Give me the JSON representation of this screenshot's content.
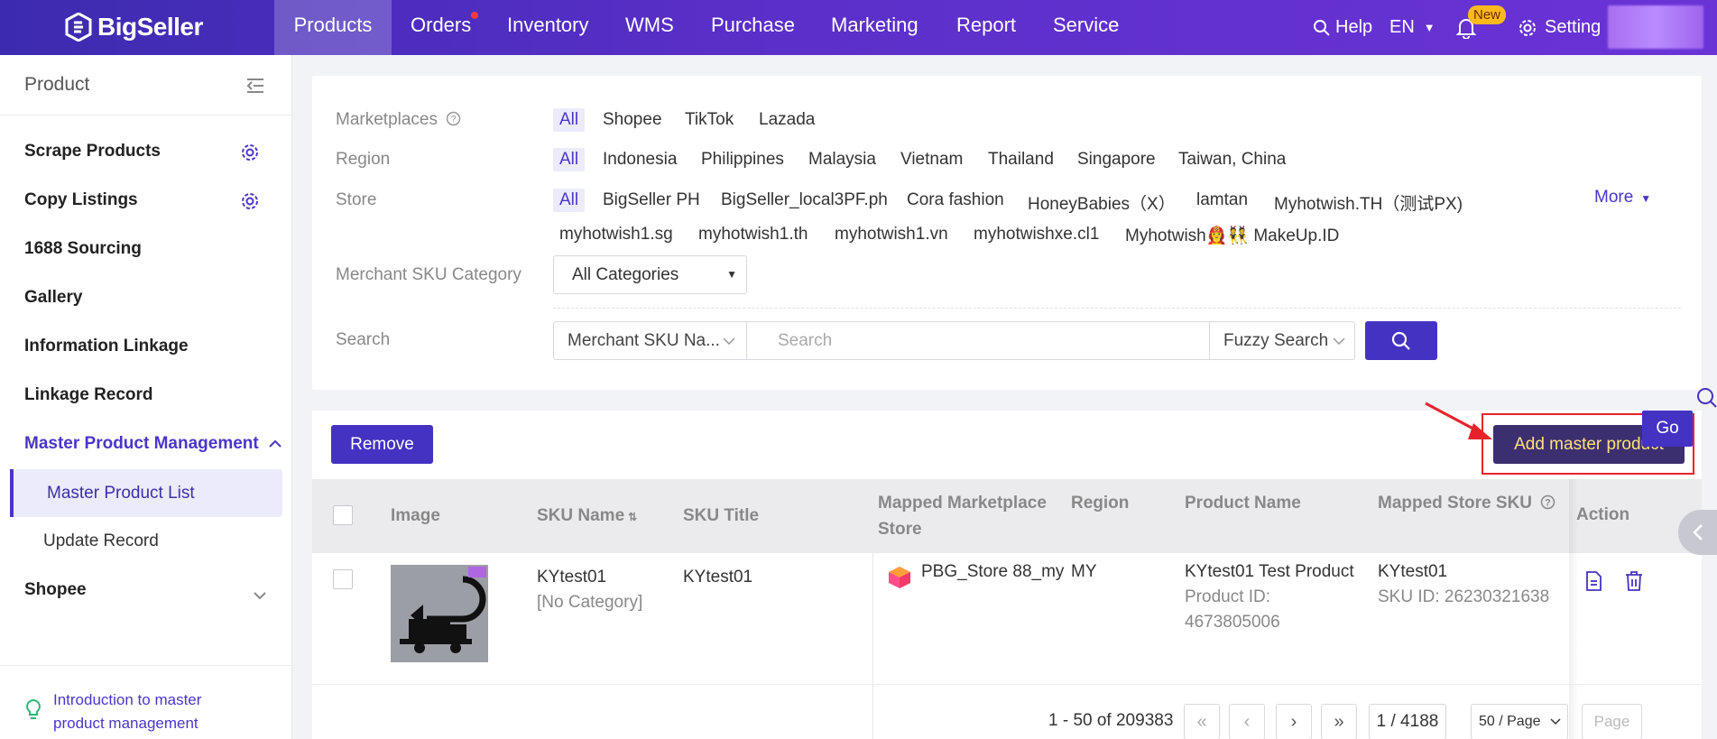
{
  "brand": {
    "name": "BigSeller"
  },
  "topnav": {
    "items": [
      "Products",
      "Orders",
      "Inventory",
      "WMS",
      "Purchase",
      "Marketing",
      "Report",
      "Service"
    ],
    "active": "Products",
    "help": "Help",
    "lang": "EN",
    "new_badge": "New",
    "setting": "Setting"
  },
  "sidebar": {
    "title": "Product",
    "items": [
      "Scrape Products",
      "Copy Listings",
      "1688 Sourcing",
      "Gallery",
      "Information Linkage",
      "Linkage Record",
      "Master Product Management",
      "Master Product List",
      "Update Record",
      "Shopee"
    ],
    "intro_link": "Introduction to master product management"
  },
  "filters": {
    "marketplaces_label": "Marketplaces",
    "marketplaces": [
      "All",
      "Shopee",
      "TikTok",
      "Lazada"
    ],
    "region_label": "Region",
    "regions": [
      "All",
      "Indonesia",
      "Philippines",
      "Malaysia",
      "Vietnam",
      "Thailand",
      "Singapore",
      "Taiwan, China"
    ],
    "store_label": "Store",
    "stores_row1": [
      "All",
      "BigSeller PH",
      "BigSeller_local3PF.ph",
      "Cora fashion",
      "HoneyBabies（X）",
      "lamtan",
      "Myhotwish.TH（测试PX)"
    ],
    "stores_row2": [
      "myhotwish1.sg",
      "myhotwish1.th",
      "myhotwish1.vn",
      "myhotwishxe.cl1",
      "Myhotwish👩‍🚒👯 MakeUp.ID"
    ],
    "more": "More",
    "category_label": "Merchant SKU Category",
    "category_value": "All Categories",
    "search_label": "Search",
    "search_field": "Merchant SKU Na...",
    "search_placeholder": "Search",
    "search_mode": "Fuzzy Search"
  },
  "list": {
    "remove_btn": "Remove",
    "add_btn": "Add master product",
    "columns": [
      "Image",
      "SKU Name",
      "SKU Title",
      "Mapped Marketplace",
      "Store",
      "Region",
      "Product Name",
      "Mapped Store SKU",
      "Action"
    ],
    "rows": [
      {
        "sku_name": "KYtest01",
        "category": "[No Category]",
        "sku_title": "KYtest01",
        "store": "PBG_Store 88_my",
        "region": "MY",
        "product_name": "KYtest01 Test Product",
        "product_id_label": "Product ID:",
        "product_id": "4673805006",
        "store_sku": "KYtest01",
        "sku_id": "SKU ID: 26230321638"
      }
    ]
  },
  "pager": {
    "summary": "1 - 50 of 209383",
    "page": "1 / 4188",
    "page_size": "50 / Page",
    "page_placeholder": "Page",
    "go": "Go"
  },
  "colors": {
    "primary": "#4432c2",
    "accent_nav": "#5b2fc9",
    "highlight_red": "#e6232a",
    "add_btn_text": "#ffe17a"
  }
}
